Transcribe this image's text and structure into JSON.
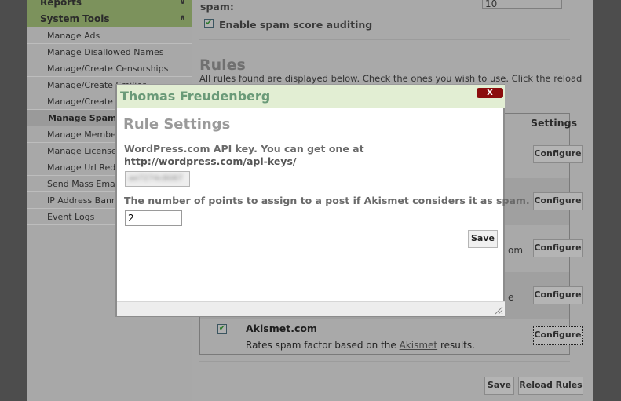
{
  "sidebar": {
    "reports_label": "Reports",
    "system_tools_label": "System Tools",
    "items": [
      {
        "label": "Manage Ads"
      },
      {
        "label": "Manage Disallowed Names"
      },
      {
        "label": "Manage/Create Censorships"
      },
      {
        "label": "Manage/Create Smilies"
      },
      {
        "label": "Manage/Create Avatars"
      },
      {
        "label": "Manage Spam Rules"
      },
      {
        "label": "Manage Member Files"
      },
      {
        "label": "Manage Licenses"
      },
      {
        "label": "Manage Url Redirects"
      },
      {
        "label": "Send Mass Email"
      },
      {
        "label": "IP Address Banning"
      },
      {
        "label": "Event Logs"
      }
    ]
  },
  "main": {
    "spam_label": "spam:",
    "spam_threshold_value": "10",
    "auditing_label": "Enable spam score auditing",
    "auditing_checked": true,
    "rules_heading": "Rules",
    "rules_description": "All rules found are displayed below. Check the ones you wish to use. Click the reload",
    "settings_header": "Settings",
    "configure_label": "Configure",
    "partial_text_row3": "om",
    "partial_text_row4": "e",
    "akismet_rule": {
      "title": "Akismet.com",
      "desc_prefix": "Rates spam factor based on the ",
      "desc_link": "Akismet",
      "desc_suffix": " results.",
      "checked": true
    },
    "save_label": "Save",
    "reload_label": "Reload Rules"
  },
  "dialog": {
    "title": "Thomas Freudenberg",
    "close_label": "X",
    "heading": "Rule Settings",
    "api_key_label": "WordPress.com API key. You can get one at",
    "api_key_link": "http://wordpress.com/api-keys/",
    "api_key_value": "ae7274c8087",
    "points_label": "The number of points to assign to a post if Akismet considers it as spam.",
    "points_value": "2",
    "save_label": "Save"
  }
}
